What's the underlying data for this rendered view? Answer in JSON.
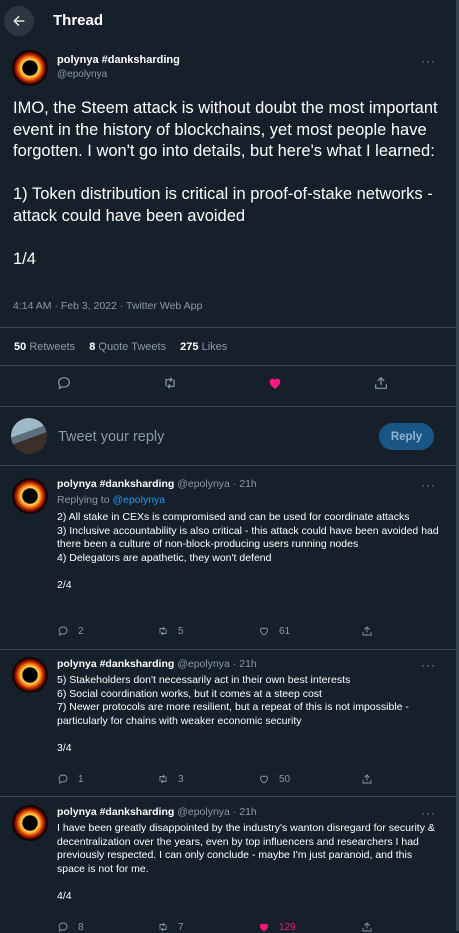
{
  "header": {
    "title": "Thread"
  },
  "main_tweet": {
    "author_name": "polynya #danksharding",
    "author_handle": "@epolynya",
    "text": "IMO, the Steem attack is without doubt the most important event in the history of blockchains, yet most people have forgotten. I won't go into details, but here's what I learned:\n\n1) Token distribution is critical in proof-of-stake networks - attack could have been avoided\n\n1/4",
    "timestamp": "4:14 AM · Feb 3, 2022 · Twitter Web App",
    "stats": {
      "retweets_count": "50",
      "retweets_label": "Retweets",
      "quotes_count": "8",
      "quotes_label": "Quote Tweets",
      "likes_count": "275",
      "likes_label": "Likes"
    }
  },
  "reply_box": {
    "placeholder": "Tweet your reply",
    "button_label": "Reply"
  },
  "replies": [
    {
      "author_name": "polynya #danksharding",
      "handle_time": "@epolynya · 21h",
      "replying_prefix": "Replying to ",
      "replying_handle": "@epolynya",
      "text": "2) All stake in CEXs is compromised and can be used for coordinate attacks\n3) Inclusive accountability is also critical - this attack could have been avoided had there been a culture of non-block-producing users running nodes\n4) Delegators are apathetic, they won't defend\n\n2/4",
      "replies": "2",
      "retweets": "5",
      "likes": "61"
    },
    {
      "author_name": "polynya #danksharding",
      "handle_time": "@epolynya · 21h",
      "text": "5) Stakeholders don't necessarily act in their own best interests\n6) Social coordination works, but it comes at a steep cost\n7) Newer protocols are more resilient, but a repeat of this is not impossible - particularly for chains with weaker economic security\n\n3/4",
      "replies": "1",
      "retweets": "3",
      "likes": "50"
    },
    {
      "author_name": "polynya #danksharding",
      "handle_time": "@epolynya · 21h",
      "text": "I have been greatly disappointed by the industry's wanton disregard for security & decentralization over the years, even by top influencers and researchers I had previously respected. I can only conclude - maybe I'm just paranoid, and this space is not for me.\n\n4/4",
      "replies": "8",
      "retweets": "7",
      "likes": "129"
    }
  ],
  "colors": {
    "background": "#15202b",
    "accent": "#1d9bf0",
    "like": "#f91880",
    "muted": "#8b98a5",
    "border": "#38444d"
  },
  "icons": [
    "back-arrow-icon",
    "more-icon",
    "reply-icon",
    "retweet-icon",
    "heart-icon",
    "share-icon"
  ]
}
